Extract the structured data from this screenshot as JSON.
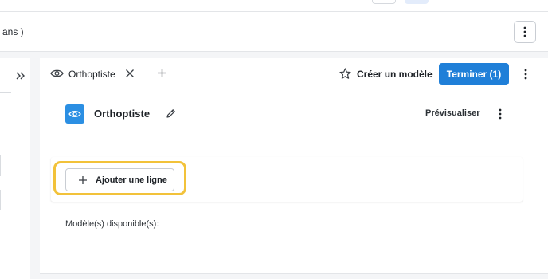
{
  "patient": {
    "text": "ans )"
  },
  "tab": {
    "label": "Orthoptiste"
  },
  "toolbar": {
    "create_model_label": "Créer un modèle",
    "finish_label": "Terminer (1)"
  },
  "document": {
    "title": "Orthoptiste",
    "preview_label": "Prévisualiser"
  },
  "add_line": {
    "label": "Ajouter une ligne"
  },
  "models": {
    "label": "Modèle(s) disponible(s):"
  },
  "colors": {
    "accent": "#1f7fd8",
    "doc_icon": "#2b8fe3",
    "highlight": "#f2c23a"
  },
  "icons": {
    "expand": "double-chevron-right-icon",
    "tab": "eye-icon",
    "close": "close-icon",
    "add_tab": "plus-icon",
    "favorite": "star-icon",
    "more": "kebab-icon",
    "edit": "pencil-icon"
  }
}
